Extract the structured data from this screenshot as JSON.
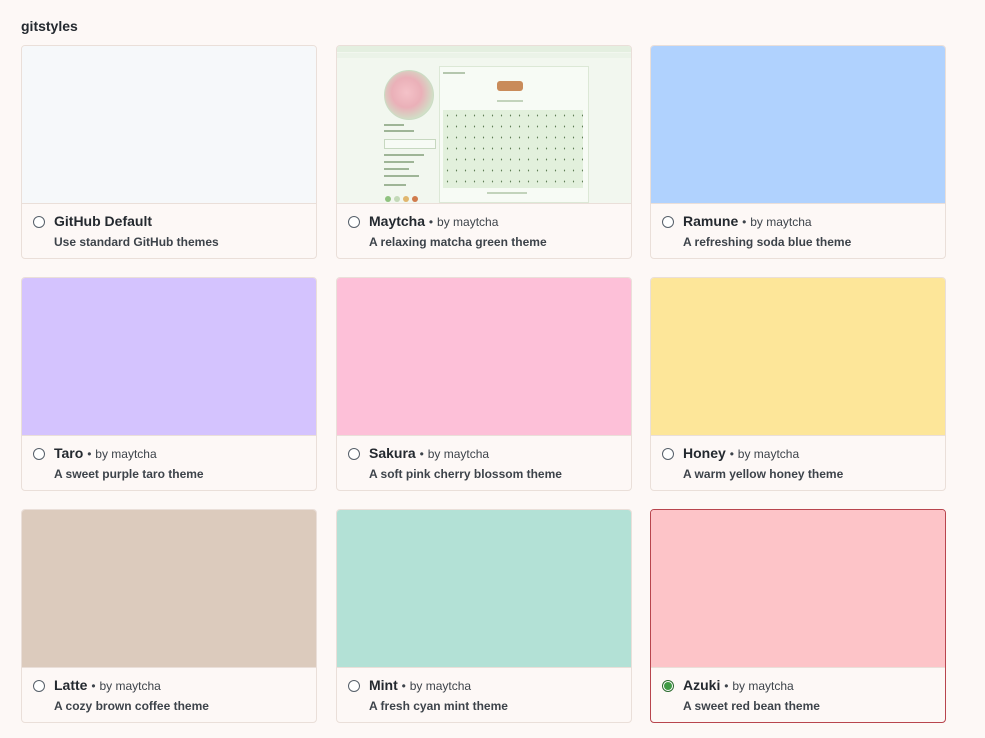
{
  "section_title": "gitstyles",
  "themes": [
    {
      "name": "GitHub Default",
      "author": "",
      "description": "Use standard GitHub themes",
      "color": "#f6f8fa",
      "selected": false
    },
    {
      "name": "Maytcha",
      "author": "by maytcha",
      "description": "A relaxing matcha green theme",
      "color": "#eaf3e6",
      "selected": false
    },
    {
      "name": "Ramune",
      "author": "by maytcha",
      "description": "A refreshing soda blue theme",
      "color": "#b0d2fe",
      "selected": false
    },
    {
      "name": "Taro",
      "author": "by maytcha",
      "description": "A sweet purple taro theme",
      "color": "#d4c3fe",
      "selected": false
    },
    {
      "name": "Sakura",
      "author": "by maytcha",
      "description": "A soft pink cherry blossom theme",
      "color": "#fdc0d8",
      "selected": false
    },
    {
      "name": "Honey",
      "author": "by maytcha",
      "description": "A warm yellow honey theme",
      "color": "#fde699",
      "selected": false
    },
    {
      "name": "Latte",
      "author": "by maytcha",
      "description": "A cozy brown coffee theme",
      "color": "#dccbbd",
      "selected": false
    },
    {
      "name": "Mint",
      "author": "by maytcha",
      "description": "A fresh cyan mint theme",
      "color": "#b3e1d6",
      "selected": false
    },
    {
      "name": "Azuki",
      "author": "by maytcha",
      "description": "A sweet red bean theme",
      "color": "#fdc4c8",
      "selected": true
    }
  ],
  "separator": "•"
}
